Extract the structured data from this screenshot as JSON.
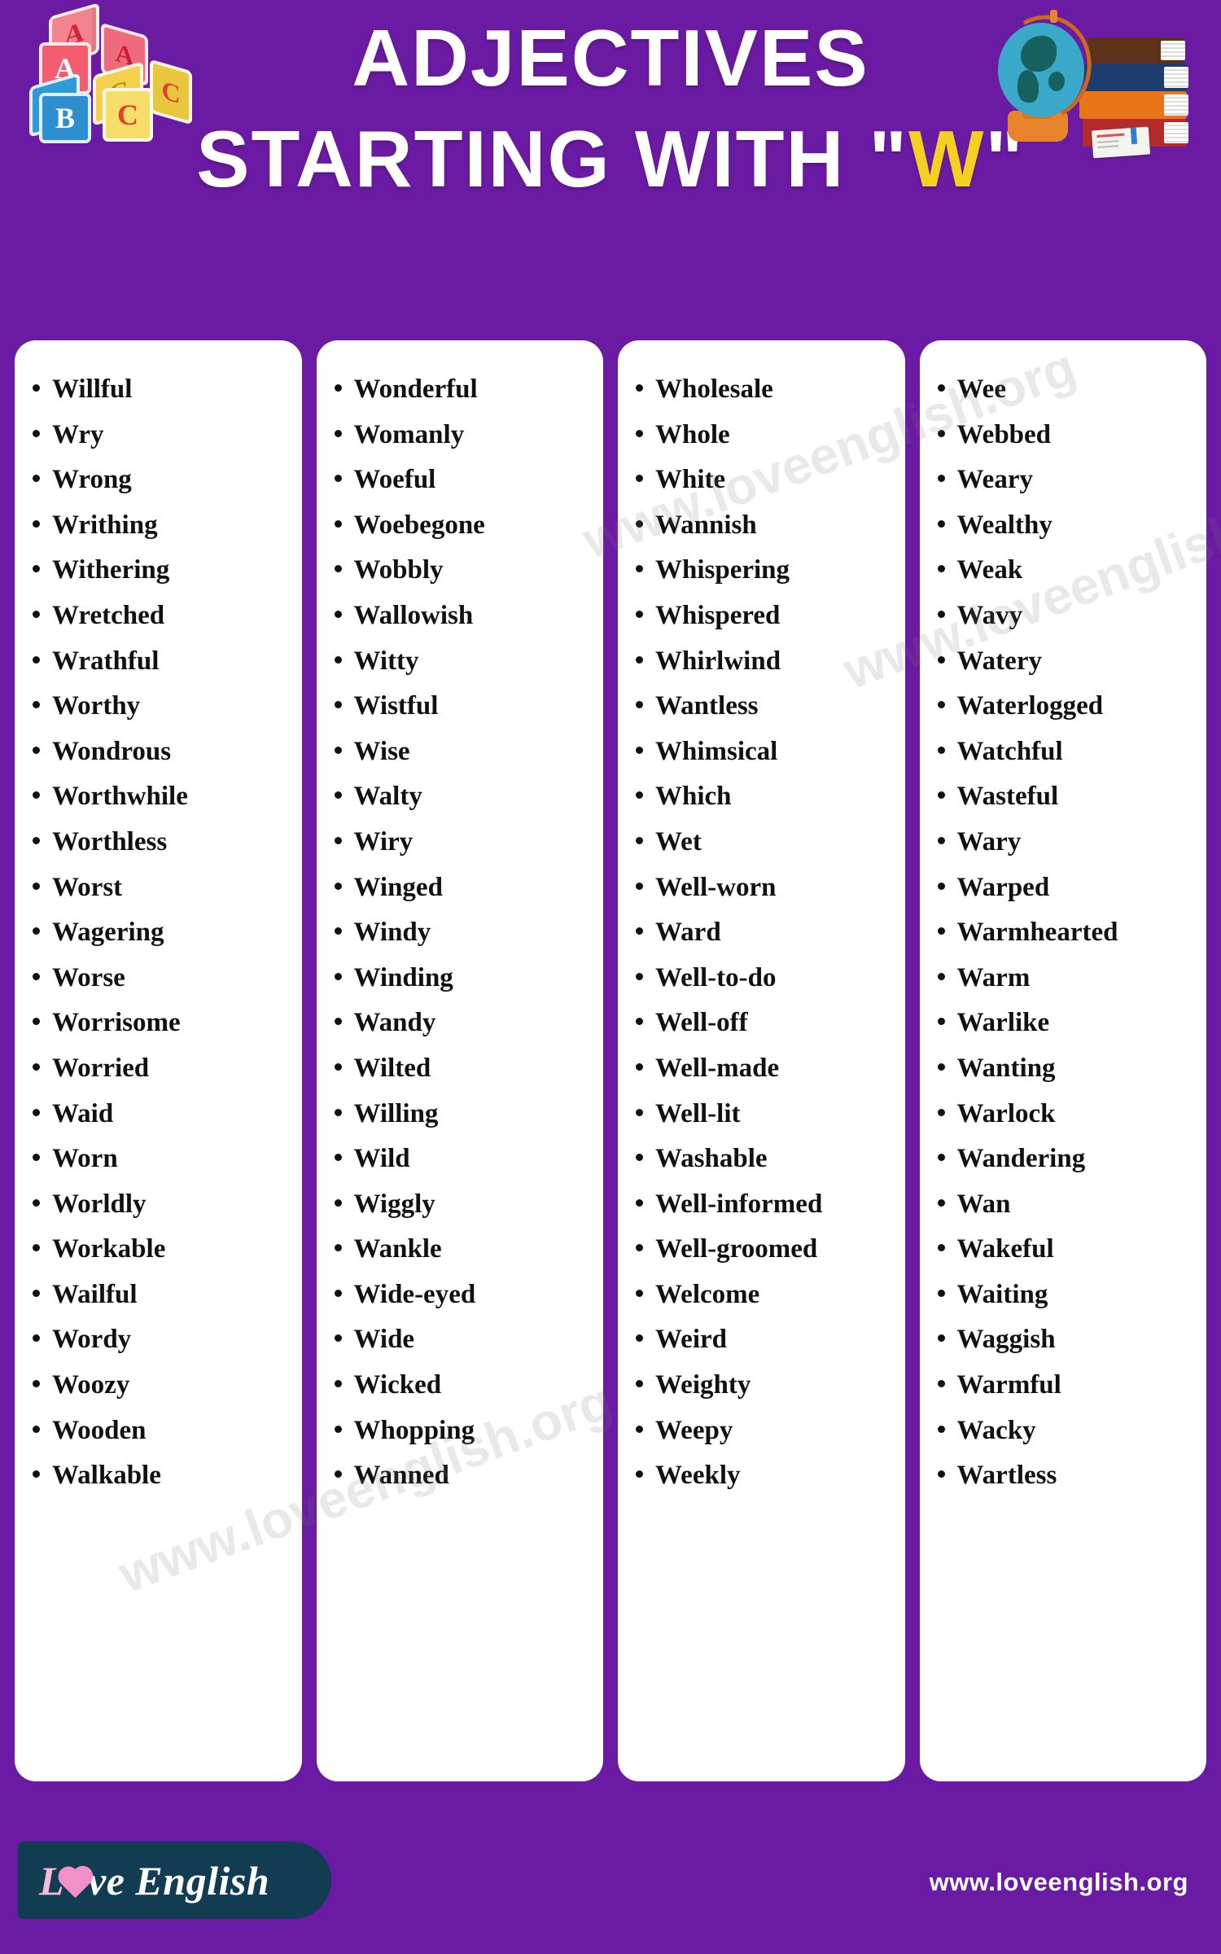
{
  "theme": {
    "background": "#6b1ba3",
    "card_background": "#ffffff",
    "title_color": "#ffffff",
    "accent_letter_color": "#f5d020",
    "text_color": "#111111",
    "logo_pill_color": "#113c52",
    "logo_heart_color": "#f490c8"
  },
  "header": {
    "title_line_1": "ADJECTIVES",
    "title_line_2_prefix": "STARTING WITH \"",
    "title_line_2_letter": "W",
    "title_line_2_suffix": "\"",
    "left_icon": "abc-blocks",
    "right_icon": "globe-and-books",
    "blocks": [
      "A",
      "A",
      "A",
      "B",
      "B",
      "C",
      "C",
      "C"
    ]
  },
  "watermarks": [
    "www.loveenglish.org",
    "www.loveenglish.org",
    "www.loveenglish.org"
  ],
  "columns": [
    {
      "id": "column-1",
      "words": [
        "Willful",
        "Wry",
        "Wrong",
        "Writhing",
        "Withering",
        "Wretched",
        "Wrathful",
        "Worthy",
        "Wondrous",
        "Worthwhile",
        "Worthless",
        "Worst",
        "Wagering",
        "Worse",
        "Worrisome",
        "Worried",
        "Waid",
        "Worn",
        "Worldly",
        "Workable",
        "Wailful",
        "Wordy",
        "Woozy",
        "Wooden",
        "Walkable"
      ]
    },
    {
      "id": "column-2",
      "words": [
        "Wonderful",
        "Womanly",
        "Woeful",
        "Woebegone",
        "Wobbly",
        "Wallowish",
        "Witty",
        "Wistful",
        "Wise",
        "Walty",
        "Wiry",
        "Winged",
        "Windy",
        "Winding",
        "Wandy",
        "Wilted",
        "Willing",
        "Wild",
        "Wiggly",
        "Wankle",
        "Wide-eyed",
        "Wide",
        "Wicked",
        "Whopping",
        "Wanned"
      ]
    },
    {
      "id": "column-3",
      "words": [
        "Wholesale",
        "Whole",
        "White",
        "Wannish",
        "Whispering",
        "Whispered",
        "Whirlwind",
        "Wantless",
        "Whimsical",
        "Which",
        "Wet",
        "Well-worn",
        "Ward",
        "Well-to-do",
        "Well-off",
        "Well-made",
        "Well-lit",
        "Washable",
        "Well-informed",
        "Well-groomed",
        "Welcome",
        "Weird",
        "Weighty",
        "Weepy",
        "Weekly"
      ]
    },
    {
      "id": "column-4",
      "words": [
        "Wee",
        "Webbed",
        "Weary",
        "Wealthy",
        "Weak",
        "Wavy",
        "Watery",
        "Waterlogged",
        "Watchful",
        "Wasteful",
        "Wary",
        "Warped",
        "Warmhearted",
        "Warm",
        "Warlike",
        "Wanting",
        "Warlock",
        "Wandering",
        "Wan",
        "Wakeful",
        "Waiting",
        "Waggish",
        "Warmful",
        "Wacky",
        "Wartless"
      ]
    }
  ],
  "footer": {
    "logo_first_letter": "L",
    "logo_heart": "heart-icon",
    "logo_rest": "ve English",
    "url": "www.loveenglish.org"
  }
}
